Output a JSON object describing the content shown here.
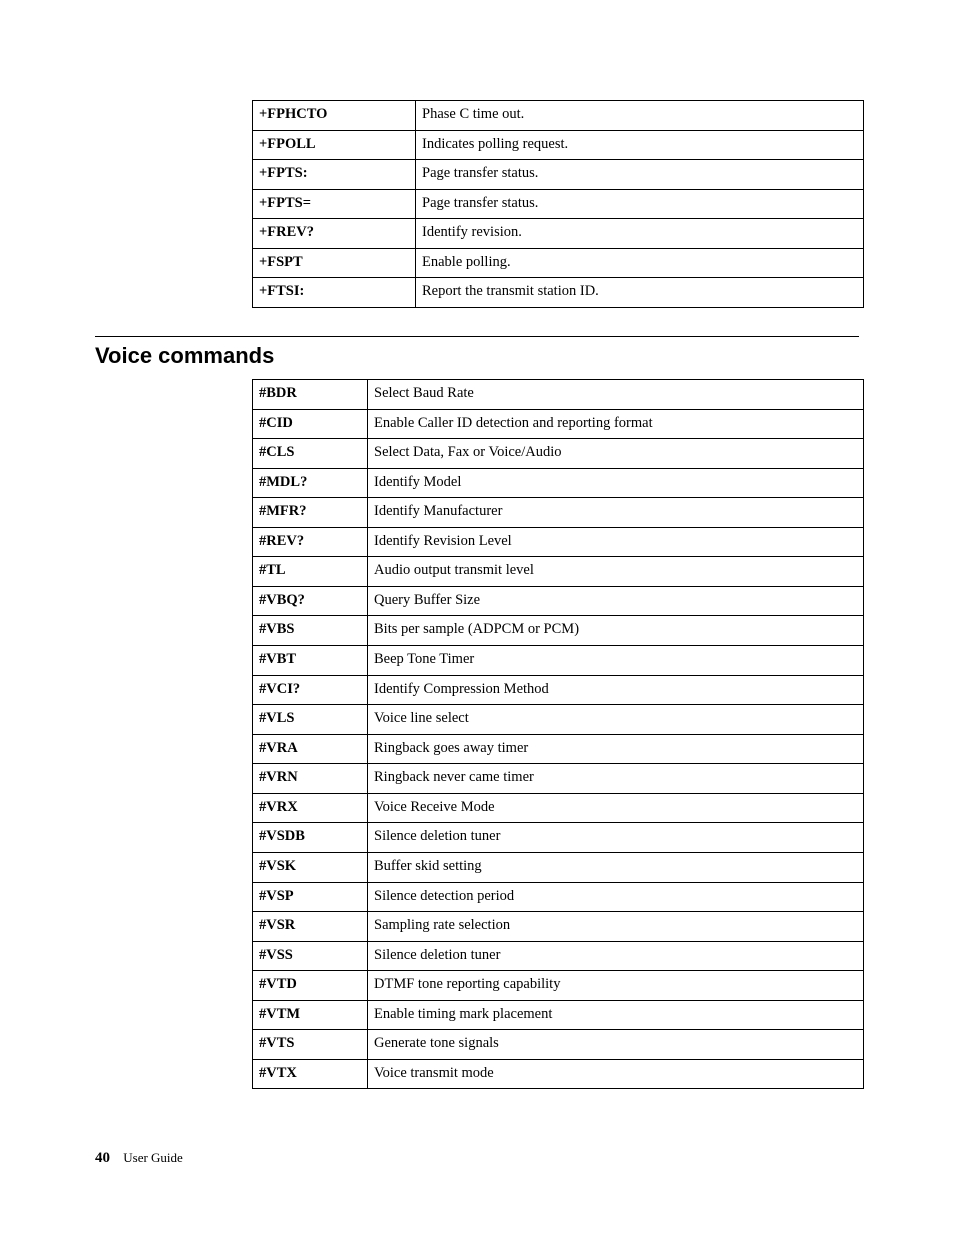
{
  "fax_table": [
    {
      "cmd": "+FPHCTO",
      "desc": "Phase C time out."
    },
    {
      "cmd": "+FPOLL",
      "desc": "Indicates polling request."
    },
    {
      "cmd": "+FPTS:",
      "desc": "Page transfer status."
    },
    {
      "cmd": "+FPTS=",
      "desc": "Page transfer status."
    },
    {
      "cmd": "+FREV?",
      "desc": "Identify revision."
    },
    {
      "cmd": "+FSPT",
      "desc": "Enable polling."
    },
    {
      "cmd": "+FTSI:",
      "desc": "Report the transmit station ID."
    }
  ],
  "section_heading": "Voice commands",
  "voice_table": [
    {
      "cmd": "#BDR",
      "desc": "Select Baud Rate"
    },
    {
      "cmd": "#CID",
      "desc": "Enable Caller ID detection and reporting format"
    },
    {
      "cmd": "#CLS",
      "desc": "Select Data, Fax or Voice/Audio"
    },
    {
      "cmd": "#MDL?",
      "desc": "Identify Model"
    },
    {
      "cmd": "#MFR?",
      "desc": "Identify Manufacturer"
    },
    {
      "cmd": "#REV?",
      "desc": "Identify Revision Level"
    },
    {
      "cmd": "#TL",
      "desc": "Audio output transmit level"
    },
    {
      "cmd": "#VBQ?",
      "desc": "Query Buffer Size"
    },
    {
      "cmd": "#VBS",
      "desc": "Bits per sample (ADPCM or PCM)"
    },
    {
      "cmd": "#VBT",
      "desc": "Beep Tone Timer"
    },
    {
      "cmd": "#VCI?",
      "desc": "Identify Compression Method"
    },
    {
      "cmd": "#VLS",
      "desc": "Voice line select"
    },
    {
      "cmd": "#VRA",
      "desc": "Ringback goes away timer"
    },
    {
      "cmd": "#VRN",
      "desc": "Ringback never came timer"
    },
    {
      "cmd": "#VRX",
      "desc": "Voice Receive Mode"
    },
    {
      "cmd": "#VSDB",
      "desc": "Silence deletion tuner"
    },
    {
      "cmd": "#VSK",
      "desc": "Buffer skid setting"
    },
    {
      "cmd": "#VSP",
      "desc": "Silence detection period"
    },
    {
      "cmd": "#VSR",
      "desc": "Sampling rate selection"
    },
    {
      "cmd": "#VSS",
      "desc": "Silence deletion tuner"
    },
    {
      "cmd": "#VTD",
      "desc": "DTMF tone reporting capability"
    },
    {
      "cmd": "#VTM",
      "desc": "Enable timing mark placement"
    },
    {
      "cmd": "#VTS",
      "desc": "Generate tone signals"
    },
    {
      "cmd": "#VTX",
      "desc": "Voice transmit mode"
    }
  ],
  "footer": {
    "page_number": "40",
    "label": "User Guide"
  }
}
